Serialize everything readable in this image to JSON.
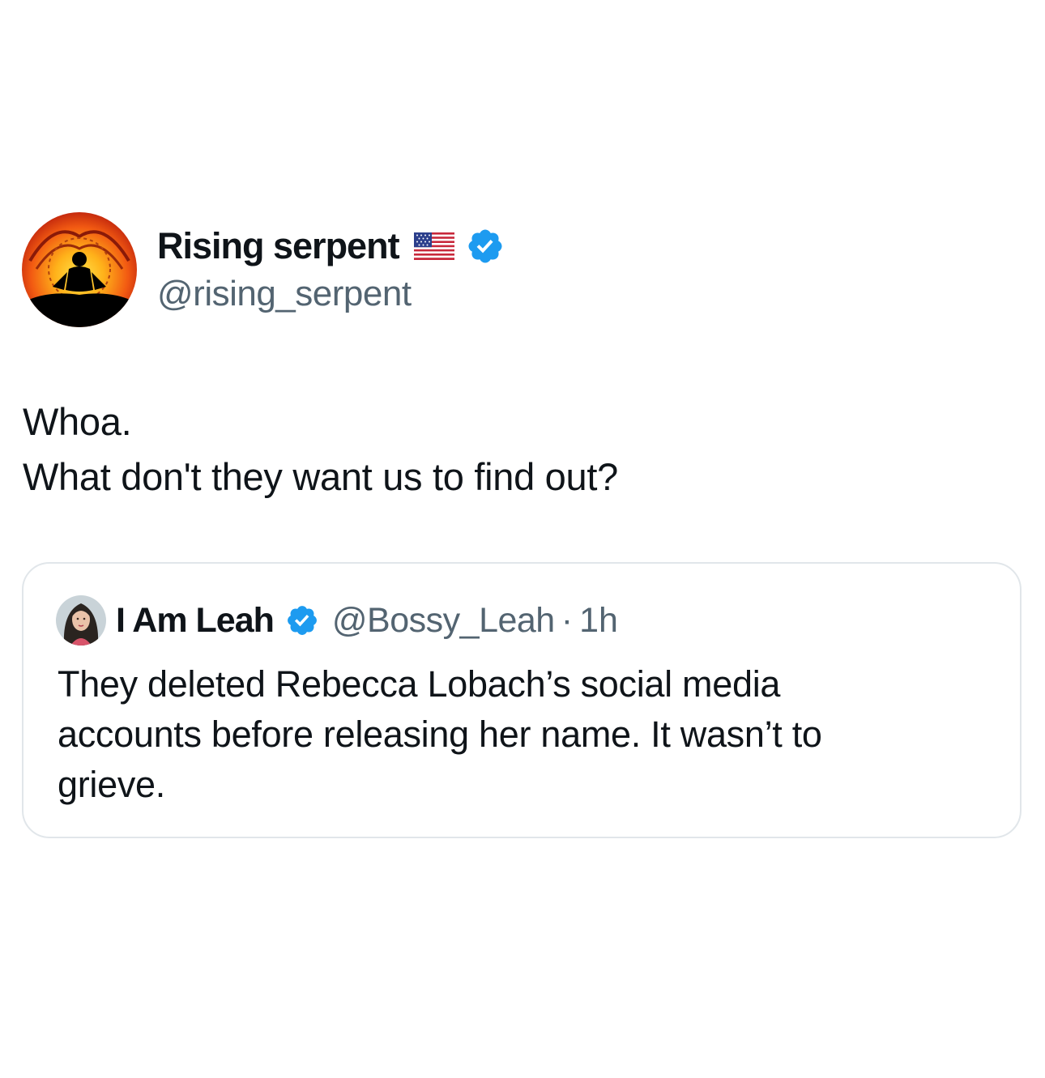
{
  "tweet": {
    "author": {
      "display_name": "Rising serpent",
      "flag_icon": "us-flag-icon",
      "verified_icon": "verified-badge-icon",
      "handle": "@rising_serpent"
    },
    "text_lines": [
      "Whoa.",
      "What don't they want us to find out?"
    ],
    "quote": {
      "author": {
        "display_name": "I Am Leah",
        "verified_icon": "verified-badge-icon",
        "handle": "@Bossy_Leah",
        "separator": "·",
        "time": "1h"
      },
      "text_lines": [
        "They deleted Rebecca Lobach’s social media",
        "accounts before releasing her name. It wasn’t to",
        "grieve."
      ]
    }
  },
  "colors": {
    "text_primary": "#0f1419",
    "text_secondary": "#536471",
    "verified_blue": "#1d9bf0",
    "card_border": "#e1e6ea"
  }
}
